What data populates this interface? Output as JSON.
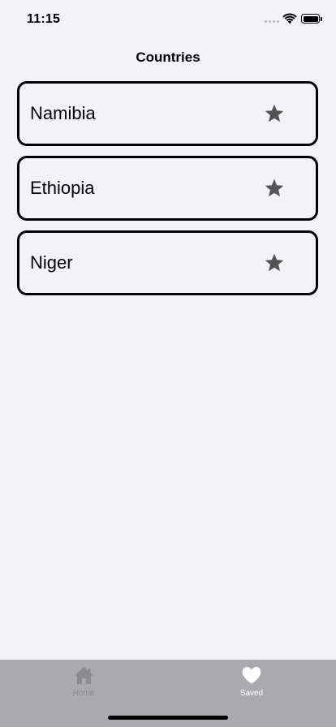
{
  "status_bar": {
    "time": "11:15",
    "icons": [
      "cellular-signal-icon",
      "wifi-icon",
      "battery-icon"
    ]
  },
  "nav": {
    "title": "Countries"
  },
  "countries": [
    {
      "name": "Namibia",
      "icon": "star-icon"
    },
    {
      "name": "Ethiopia",
      "icon": "star-icon"
    },
    {
      "name": "Niger",
      "icon": "star-icon"
    }
  ],
  "tab_bar": {
    "tabs": [
      {
        "label": "Home",
        "icon": "house-icon",
        "selected": false
      },
      {
        "label": "Saved",
        "icon": "heart-icon",
        "selected": true
      }
    ]
  },
  "colors": {
    "background": "#f2f2f7",
    "star": "#555555",
    "tab_bar": "#aaaaae",
    "tab_inactive": "#8b8b8f",
    "tab_active": "#ffffff"
  }
}
